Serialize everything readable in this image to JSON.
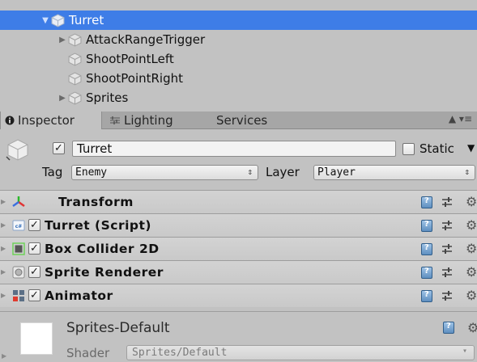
{
  "hierarchy": {
    "items": [
      {
        "label": "Turret",
        "expanded": true,
        "selected": true
      },
      {
        "label": "AttackRangeTrigger",
        "expanded": false
      },
      {
        "label": "ShootPointLeft"
      },
      {
        "label": "ShootPointRight"
      },
      {
        "label": "Sprites",
        "expanded": false
      }
    ]
  },
  "tabs": [
    {
      "label": "Inspector",
      "icon": "info-icon",
      "active": true
    },
    {
      "label": "Lighting",
      "icon": "lighting-icon",
      "active": false
    },
    {
      "label": "Services",
      "active": false
    }
  ],
  "tab_menu": "▲ ▾≡",
  "object": {
    "active": true,
    "name": "Turret",
    "static_label": "Static",
    "static": false,
    "tag_label": "Tag",
    "tag": "Enemy",
    "layer_label": "Layer",
    "layer": "Player"
  },
  "components": [
    {
      "name": "Transform",
      "icon": "transform-axes-icon",
      "has_checkbox": false
    },
    {
      "name": "Turret (Script)",
      "icon": "csharp-script-icon",
      "has_checkbox": true,
      "enabled": true
    },
    {
      "name": "Box Collider 2D",
      "icon": "box-collider-2d-icon",
      "has_checkbox": true,
      "enabled": true
    },
    {
      "name": "Sprite Renderer",
      "icon": "sprite-renderer-icon",
      "has_checkbox": true,
      "enabled": true
    },
    {
      "name": "Animator",
      "icon": "animator-icon",
      "has_checkbox": true,
      "enabled": true
    }
  ],
  "material": {
    "name": "Sprites-Default",
    "shader_label": "Shader",
    "shader": "Sprites/Default"
  },
  "colors": {
    "selection": "#3e7de7",
    "panel": "#c2c2c2",
    "tab_bar": "#a6a6a6",
    "header_bar": "#d3d3d3"
  }
}
